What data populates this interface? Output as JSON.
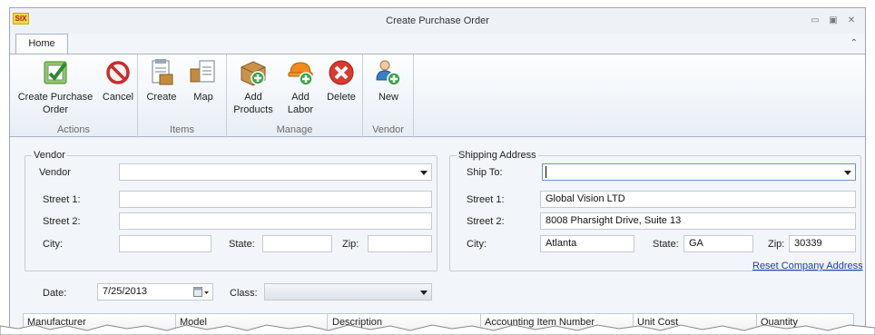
{
  "window": {
    "logo_text": "SIX",
    "title": "Create Purchase Order",
    "minimize": "▭",
    "restore": "▣",
    "close": "✕",
    "collapse_ribbon": "⌃"
  },
  "tabs": [
    {
      "label": "Home"
    }
  ],
  "ribbon": {
    "groups": [
      {
        "label": "Actions",
        "buttons": [
          {
            "label": "Create Purchase Order",
            "label_line1": "Create Purchase",
            "label_line2": "Order",
            "icon": "create-purchase-order-icon"
          },
          {
            "label": "Cancel",
            "icon": "cancel-icon"
          }
        ]
      },
      {
        "label": "Items",
        "buttons": [
          {
            "label": "Create",
            "icon": "create-item-icon"
          },
          {
            "label": "Map",
            "icon": "map-icon"
          }
        ]
      },
      {
        "label": "Manage",
        "buttons": [
          {
            "label": "Add Products",
            "label_line1": "Add",
            "label_line2": "Products",
            "icon": "add-products-icon"
          },
          {
            "label": "Add Labor",
            "label_line1": "Add",
            "label_line2": "Labor",
            "icon": "add-labor-icon"
          },
          {
            "label": "Delete",
            "icon": "delete-icon"
          }
        ]
      },
      {
        "label": "Vendor",
        "buttons": [
          {
            "label": "New",
            "icon": "new-vendor-icon"
          }
        ]
      }
    ]
  },
  "vendor": {
    "legend": "Vendor",
    "vendor_label": "Vendor",
    "vendor_value": "",
    "street1_label": "Street 1:",
    "street1_value": "",
    "street2_label": "Street 2:",
    "street2_value": "",
    "city_label": "City:",
    "city_value": "",
    "state_label": "State:",
    "state_value": "",
    "zip_label": "Zip:",
    "zip_value": ""
  },
  "shipping": {
    "legend": "Shipping Address",
    "ship_to_label": "Ship To:",
    "ship_to_value": "",
    "street1_label": "Street 1:",
    "street1_value": "Global Vision LTD",
    "street2_label": "Street 2:",
    "street2_value": "8008 Pharsight Drive, Suite 13",
    "city_label": "City:",
    "city_value": "Atlanta",
    "state_label": "State:",
    "state_value": "GA",
    "zip_label": "Zip:",
    "zip_value": "30339",
    "reset_link": "Reset Company Address"
  },
  "order": {
    "date_label": "Date:",
    "date_value": "7/25/2013",
    "class_label": "Class:",
    "class_value": ""
  },
  "grid": {
    "columns": [
      "Manufacturer",
      "Model",
      "Description",
      "Accounting Item Number",
      "Unit Cost",
      "Quantity"
    ]
  },
  "colors": {
    "accent_link": "#1d3fb0",
    "ribbon_border": "#a7b4c6",
    "window_bg": "#f2f5f9"
  }
}
